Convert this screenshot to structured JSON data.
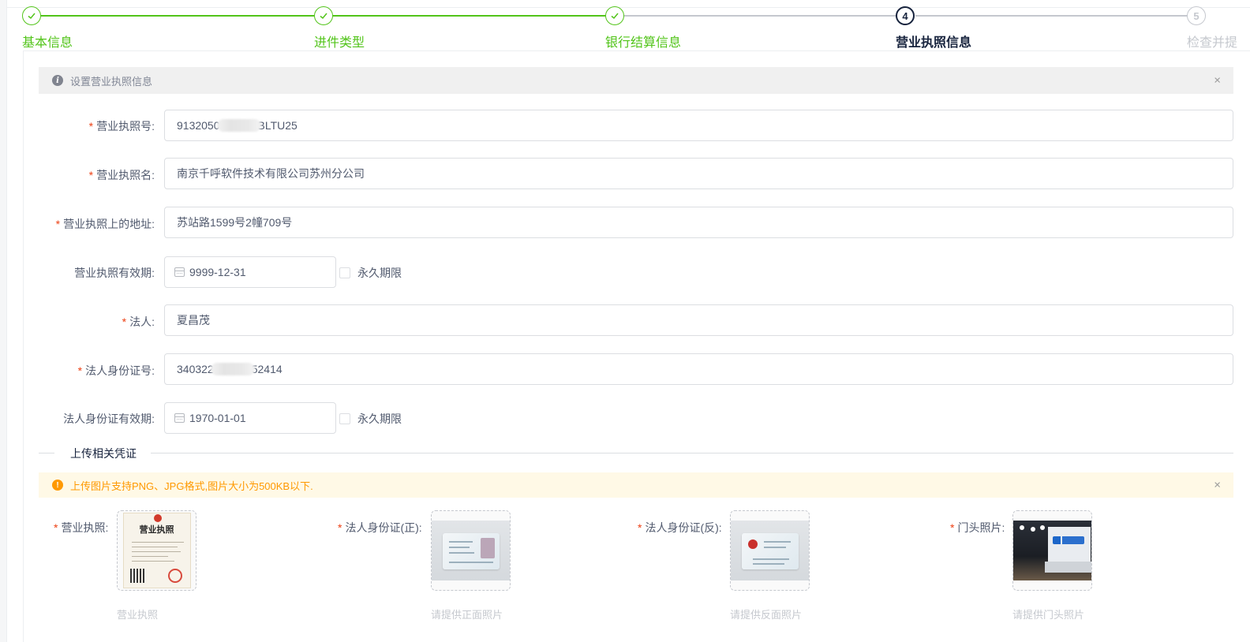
{
  "steps": [
    {
      "title": "基本信息",
      "status": "done"
    },
    {
      "title": "进件类型",
      "status": "done"
    },
    {
      "title": "银行结算信息",
      "status": "done"
    },
    {
      "title": "营业执照信息",
      "status": "current",
      "number": "4"
    },
    {
      "title": "检查并提",
      "status": "wait",
      "number": "5"
    }
  ],
  "info_alert": {
    "text": "设置营业执照信息",
    "close": "×"
  },
  "form": {
    "license_no": {
      "label": "营业执照号:",
      "value_start": "9132050",
      "value_end": "BLTU25"
    },
    "license_name": {
      "label": "营业执照名:",
      "value": "南京千呼软件技术有限公司苏州分公司"
    },
    "license_address": {
      "label": "营业执照上的地址:",
      "value": "苏站路1599号2幢709号"
    },
    "license_validity": {
      "label": "营业执照有效期:",
      "value": "9999-12-31",
      "checkbox_label": "永久期限"
    },
    "legal_person": {
      "label": "法人:",
      "value": "夏昌茂"
    },
    "legal_id_no": {
      "label": "法人身份证号:",
      "value_start": "340322",
      "value_end": "52414"
    },
    "legal_id_validity": {
      "label": "法人身份证有效期:",
      "value": "1970-01-01",
      "checkbox_label": "永久期限"
    }
  },
  "divider_text": "上传相关凭证",
  "warn_alert": {
    "text": "上传图片支持PNG、JPG格式,图片大小为500KB以下.",
    "close": "×"
  },
  "uploads": [
    {
      "label": "营业执照:",
      "caption": "营业执照",
      "thumb_text": "营业执照"
    },
    {
      "label": "法人身份证(正):",
      "caption": "请提供正面照片"
    },
    {
      "label": "法人身份证(反):",
      "caption": "请提供反面照片"
    },
    {
      "label": "门头照片:",
      "caption": "请提供门头照片"
    }
  ],
  "colors": {
    "done": "#52c41a",
    "current": "#17233d",
    "wait": "#c5c8ce",
    "required": "#ed4014",
    "warning": "#ff9900"
  }
}
